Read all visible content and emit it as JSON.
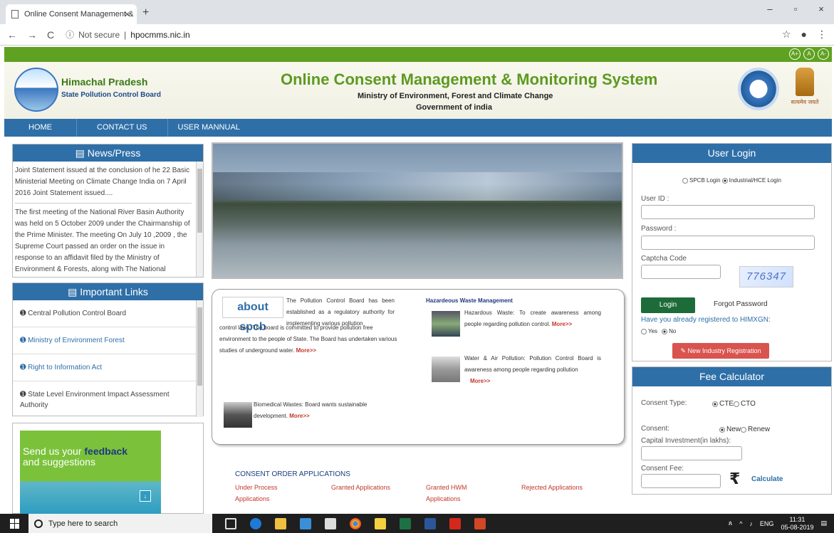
{
  "browser": {
    "tab_title": "Online Consent Management &",
    "tab_close": "×",
    "new_tab": "+",
    "win_min": "–",
    "win_max": "▫",
    "win_close": "×",
    "back": "←",
    "forward": "→",
    "reload": "C",
    "security": "Not secure",
    "url": "hpocmms.nic.in",
    "info_icon": "ⓘ",
    "star": "☆",
    "account": "●",
    "menu": "⋮"
  },
  "accessibility": [
    "A+",
    "A",
    "A-"
  ],
  "header": {
    "org_name": "Himachal Pradesh",
    "org_sub": "State Pollution Control Board",
    "title": "Online Consent Management & Monitoring System",
    "ministry": "Ministry of Environment, Forest and Climate Change",
    "govt": "Government of india",
    "emblem_text": "सत्यमेव जयते"
  },
  "menu": [
    "HOME",
    "CONTACT US",
    "USER MANNUAL"
  ],
  "news": {
    "title": "News/Press",
    "items": [
      "Joint Statement issued at the conclusion of he 22 Basic Ministerial Meeting on Climate Change India on 7 April 2016 Joint Statement issued....",
      "The first meeting of the National River Basin Authority was held on 5 October 2009 under the Chairmanship of the Prime Minister. The meeting On July 10 ,2009 , the Supreme Court passed an order on the issue in response to an affidavit filed by the Ministry of Environment & Forests, along with The National"
    ]
  },
  "links": {
    "title": "Important Links",
    "items": [
      "Central Pollution Control Board",
      "Ministry of Environment Forest",
      "Right to Information Act",
      "State Level Environment Impact Assessment Authority"
    ]
  },
  "feedback": {
    "line1": "Send us your ",
    "bold": "feedback",
    "line2": "and suggestions"
  },
  "about": {
    "logo": "about spcb",
    "text": "The Pollution Control Board has been established as a regulatory authority for implementing various pollution",
    "cont": "control laws. The board is committed to provide pollution free environment to the people of State. The Board has undertaken various studies of underground water.",
    "more": "More>>"
  },
  "hwm": {
    "title": "Hazardeous Waste Management",
    "item1": "Hazardous Waste: To create awareness among people regarding pollution control.",
    "item2": "Water & Air Pollution: Pollution Control Board is awareness among people regarding pollution",
    "bio": "Biomedical Wastes: Board wants sustainable development.",
    "more": "More>>"
  },
  "consent": {
    "title": "CONSENT ORDER APPLICATIONS",
    "links": [
      "Under Process Applications",
      "Granted Applications",
      "Granted HWM Applications",
      "Rejected Applications"
    ]
  },
  "login": {
    "title": "User Login",
    "spcb": "SPCB Login",
    "industrial": "Industrial/HCE Login",
    "user_id": "User ID :",
    "password": "Password :",
    "captcha_label": "Captcha Code",
    "captcha": "776347",
    "login_btn": "Login",
    "forgot": "Forgot Password",
    "reg_q": "Have you already registered to HIMXGN:",
    "yes": "Yes",
    "no": "No",
    "new_reg": "✎ New Industry Registration"
  },
  "fee": {
    "title": "Fee Calculator",
    "consent_type": "Consent Type:",
    "cte": "CTE",
    "cto": "CTO",
    "consent": "Consent:",
    "new": "New",
    "renew": "Renew",
    "capital": "Capital Investment(in lakhs):",
    "fee": "Consent Fee:",
    "rupee": "₹",
    "calculate": "Calculate"
  },
  "taskbar": {
    "search": "Type here to search",
    "lang": "ENG",
    "time": "11:31",
    "date": "05-08-2019"
  },
  "colors": {
    "green": "#5fa120",
    "blue": "#2e6fa8",
    "red": "#d9534f",
    "dark_green": "#1e6b3a"
  }
}
